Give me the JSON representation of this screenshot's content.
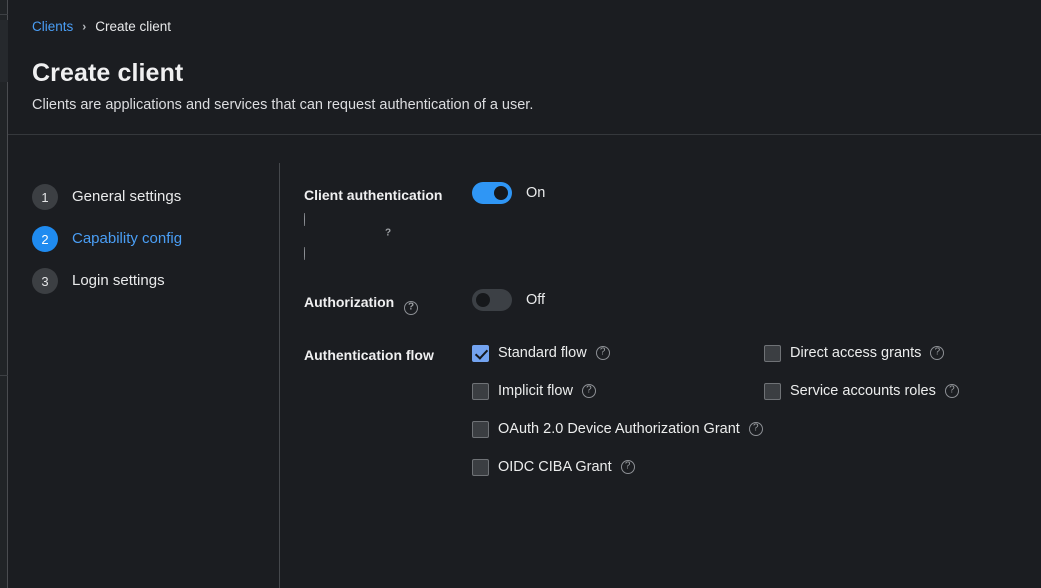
{
  "breadcrumb": {
    "link_label": "Clients",
    "separator": "›",
    "current_label": "Create client"
  },
  "header": {
    "title": "Create client",
    "subtitle": "Clients are applications and services that can request authentication of a user."
  },
  "stepper": {
    "steps": [
      {
        "number": "1",
        "label": "General settings",
        "active": false
      },
      {
        "number": "2",
        "label": "Capability config",
        "active": true
      },
      {
        "number": "3",
        "label": "Login settings",
        "active": false
      }
    ]
  },
  "form": {
    "client_authentication": {
      "label": "Client authentication",
      "state_label": "On",
      "enabled": true,
      "help": "?"
    },
    "authorization": {
      "label": "Authorization",
      "state_label": "Off",
      "enabled": false,
      "help": "?"
    },
    "authentication_flow": {
      "label": "Authentication flow",
      "options": [
        {
          "label": "Standard flow",
          "checked": true,
          "help": "?"
        },
        {
          "label": "Direct access grants",
          "checked": false,
          "help": "?"
        },
        {
          "label": "Implicit flow",
          "checked": false,
          "help": "?"
        },
        {
          "label": "Service accounts roles",
          "checked": false,
          "help": "?"
        },
        {
          "label": "OAuth 2.0 Device Authorization Grant",
          "checked": false,
          "help": "?"
        },
        {
          "label": "OIDC CIBA Grant",
          "checked": false,
          "help": "?"
        }
      ]
    }
  },
  "colors": {
    "page_background": "#1b1d21",
    "accent_blue": "#2f96f5",
    "link_blue": "#4a9ef5",
    "checkbox_checked": "#73a3f0",
    "toggle_off_track": "#3c4045",
    "step_inactive": "#3c3f43",
    "divider": "#45484c"
  }
}
